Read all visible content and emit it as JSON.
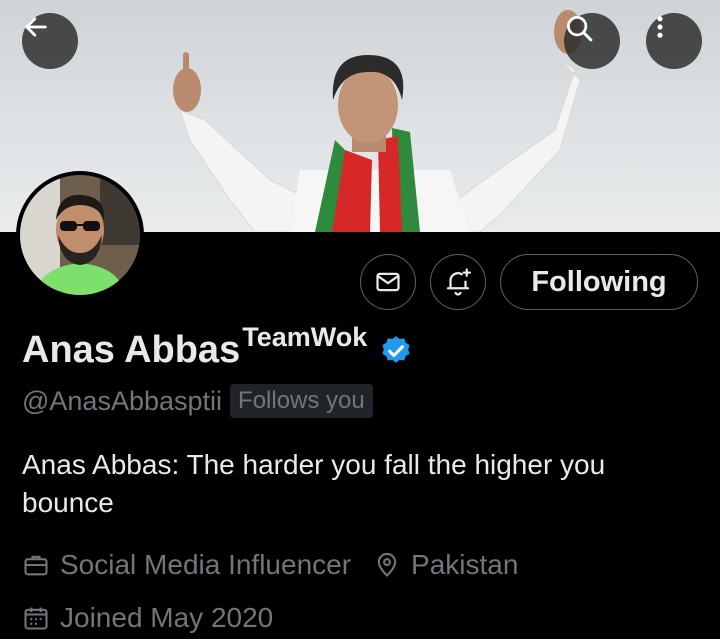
{
  "profile": {
    "display_name": "Anas Abbas",
    "name_suffix": "TeamWok",
    "handle": "@AnasAbbasptii",
    "follows_you_badge": "Follows you",
    "bio": "Anas Abbas: The harder you fall the higher you bounce",
    "category": "Social Media Influencer",
    "location": "Pakistan",
    "joined": "Joined May 2020",
    "verified": true
  },
  "actions": {
    "following_label": "Following"
  },
  "icons": {
    "back": "arrow-left-icon",
    "search": "search-icon",
    "more": "more-vertical-icon",
    "message": "envelope-icon",
    "notifications": "bell-plus-icon",
    "verified": "verified-badge-icon",
    "category": "briefcase-icon",
    "location": "map-pin-icon",
    "joined": "calendar-icon"
  },
  "colors": {
    "background": "#000000",
    "text_primary": "#e7e9ea",
    "text_secondary": "#71767b",
    "border": "#536471",
    "verified_blue": "#1d9bf0",
    "badge_bg": "#202327"
  }
}
